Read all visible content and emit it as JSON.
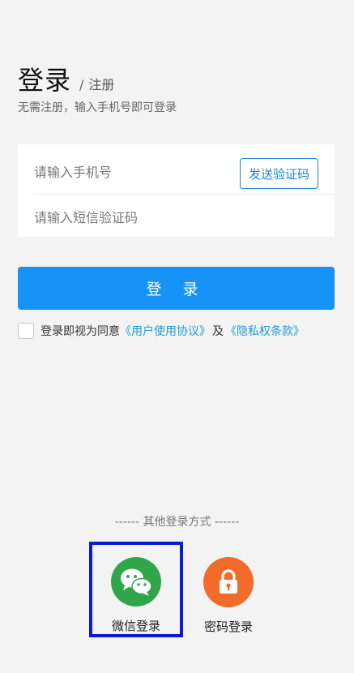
{
  "header": {
    "title": "登录",
    "separator": "/",
    "alt_link": "注册",
    "subtitle": "无需注册，输入手机号即可登录"
  },
  "form": {
    "phone_placeholder": "请输入手机号",
    "send_code_label": "发送验证码",
    "code_placeholder": "请输入短信验证码"
  },
  "login_button": "登 录",
  "agreement": {
    "prefix": "登录即视为同意",
    "user_agreement": "《用户使用协议》",
    "and": "及",
    "privacy": "《隐私权条款》"
  },
  "other_methods": {
    "title": "------ 其他登录方式 ------",
    "wechat_label": "微信登录",
    "password_label": "密码登录"
  },
  "colors": {
    "primary": "#1692f8",
    "link": "#1f9ad8",
    "wechat": "#2fa64a",
    "password": "#f26b2a",
    "highlight": "#0a1bd6"
  },
  "icons": {
    "wechat": "wechat-icon",
    "password": "lock-icon"
  }
}
